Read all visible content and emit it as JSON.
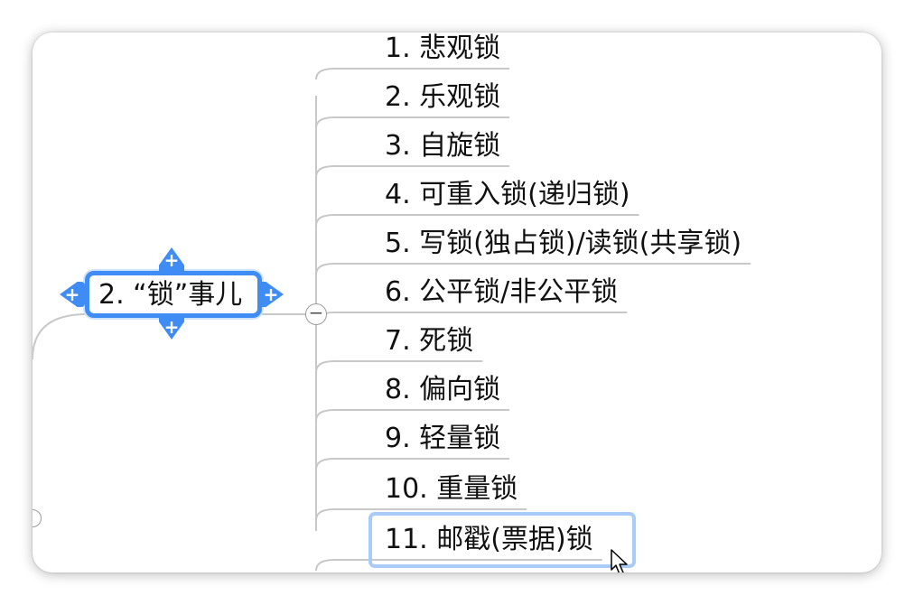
{
  "mindmap": {
    "central_topic": "2. “锁”事儿",
    "subtopics": [
      "1. 悲观锁",
      "2. 乐观锁",
      "3. 自旋锁",
      "4. 可重入锁(递归锁)",
      "5. 写锁(独占锁)/读锁(共享锁)",
      "6. 公平锁/非公平锁",
      "7. 死锁",
      "8. 偏向锁",
      "9. 轻量锁",
      "10. 重量锁",
      "11. 邮戳(票据)锁"
    ],
    "selected_subtopic_index": 10,
    "colors": {
      "selection_blue": "#3f8cf4",
      "selection_light": "#a9cbf7",
      "connector": "#c8c8c8"
    },
    "icons": {
      "add": "plus-icon",
      "collapse": "minus-icon",
      "cursor": "arrow-cursor-icon"
    }
  }
}
